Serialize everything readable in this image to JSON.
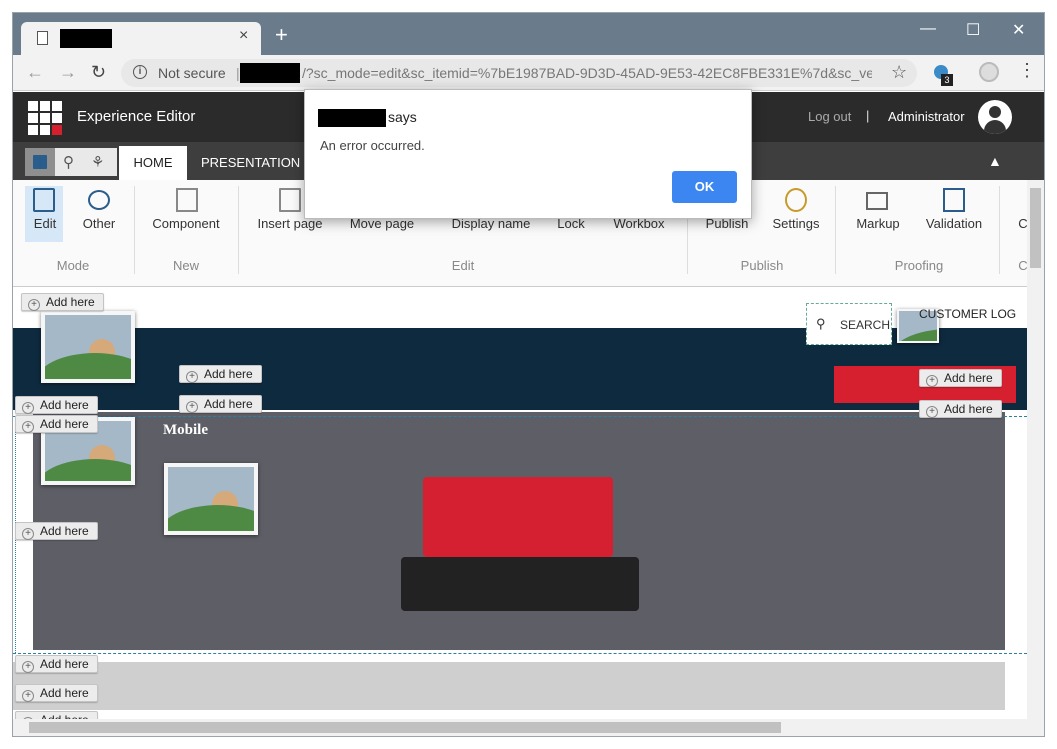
{
  "browser": {
    "tab_title": "",
    "new_tab_symbol": "+",
    "tab_close_symbol": "×",
    "not_secure_label": "Not secure",
    "url_text": "/?sc_mode=edit&sc_itemid=%7bE1987BAD-9D3D-45AD-9E53-42EC8FBE331E%7d&sc_vers...",
    "extension_badge": "3",
    "window_controls": {
      "minimize": "—",
      "maximize": "☐",
      "close": "✕"
    }
  },
  "app_header": {
    "title": "Experience Editor",
    "logout_label": "Log out",
    "separator": "|",
    "user_name": "Administrator"
  },
  "ribbon": {
    "tabs": [
      {
        "label": "HOME",
        "active": true
      },
      {
        "label": "PRESENTATION",
        "active": false
      }
    ],
    "buttons": {
      "edit": "Edit",
      "other": "Other",
      "component": "Component",
      "insert_page": "Insert page",
      "move_page": "Move page",
      "display_name": "Display name",
      "lock": "Lock",
      "workbox": "Workbox",
      "publish": "Publish",
      "settings": "Settings",
      "markup": "Markup",
      "validation": "Validation",
      "cut_c": "C"
    },
    "groups": {
      "mode": "Mode",
      "new": "New",
      "edit": "Edit",
      "publish": "Publish",
      "proofing": "Proofing",
      "cut_c": "C"
    }
  },
  "page": {
    "search_label": "SEARCH",
    "customer_login_label": "CUSTOMER LOG",
    "mobile_label": "Mobile",
    "add_here_label": "Add here"
  },
  "dialog": {
    "says_label": "says",
    "message": "An error occurred.",
    "ok_label": "OK"
  },
  "colors": {
    "titlebar": "#6a7b8c",
    "sc_header": "#2b2b2b",
    "navbar": "#0e2a3e",
    "accent_red": "#d62030",
    "ok_button": "#3b86f0",
    "mobile_section": "#5e5e66"
  },
  "icons": {
    "back": "arrow-left-icon",
    "forward": "arrow-right-icon",
    "reload": "reload-icon",
    "info": "info-icon",
    "bookmark": "star-icon",
    "menu": "kebab-menu-icon",
    "save": "save-icon",
    "search": "search-icon",
    "tree": "tree-icon",
    "collapse": "chevron-up-icon"
  }
}
